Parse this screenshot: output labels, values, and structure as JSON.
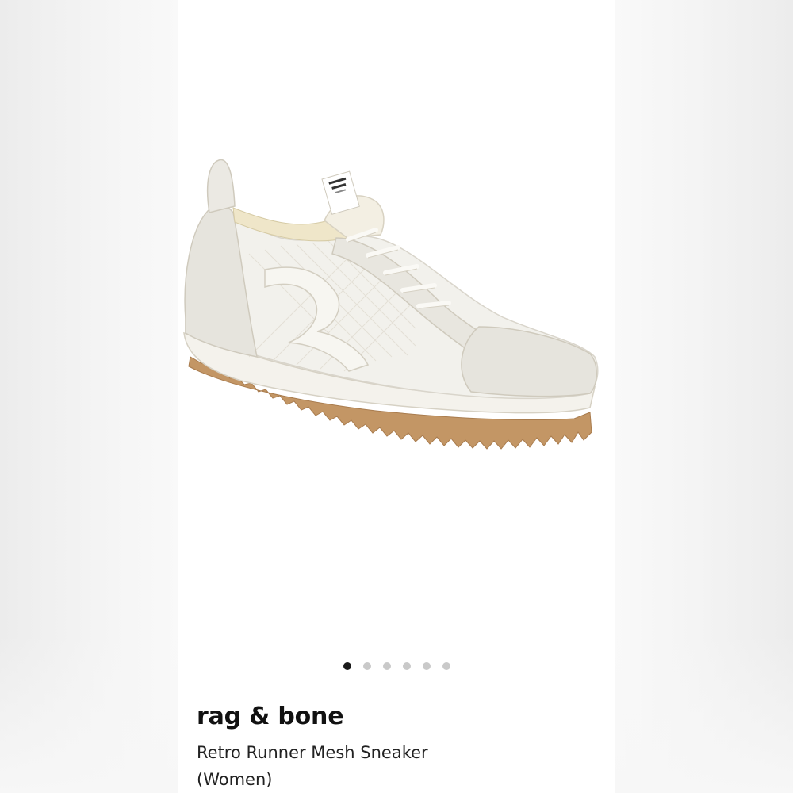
{
  "product": {
    "brand": "rag & bone",
    "name": "Retro Runner Mesh Sneaker (Women)",
    "image_icon": "white-sneaker-image",
    "heel_label_line1": "rag & bone",
    "heel_label_line2": "new york"
  },
  "carousel": {
    "total": 6,
    "active": 1
  },
  "colors": {
    "sole_gum": "#c39665",
    "upper": "#efede6",
    "dot_active": "#1a1a1a",
    "dot_inactive": "#c9c9c9"
  }
}
